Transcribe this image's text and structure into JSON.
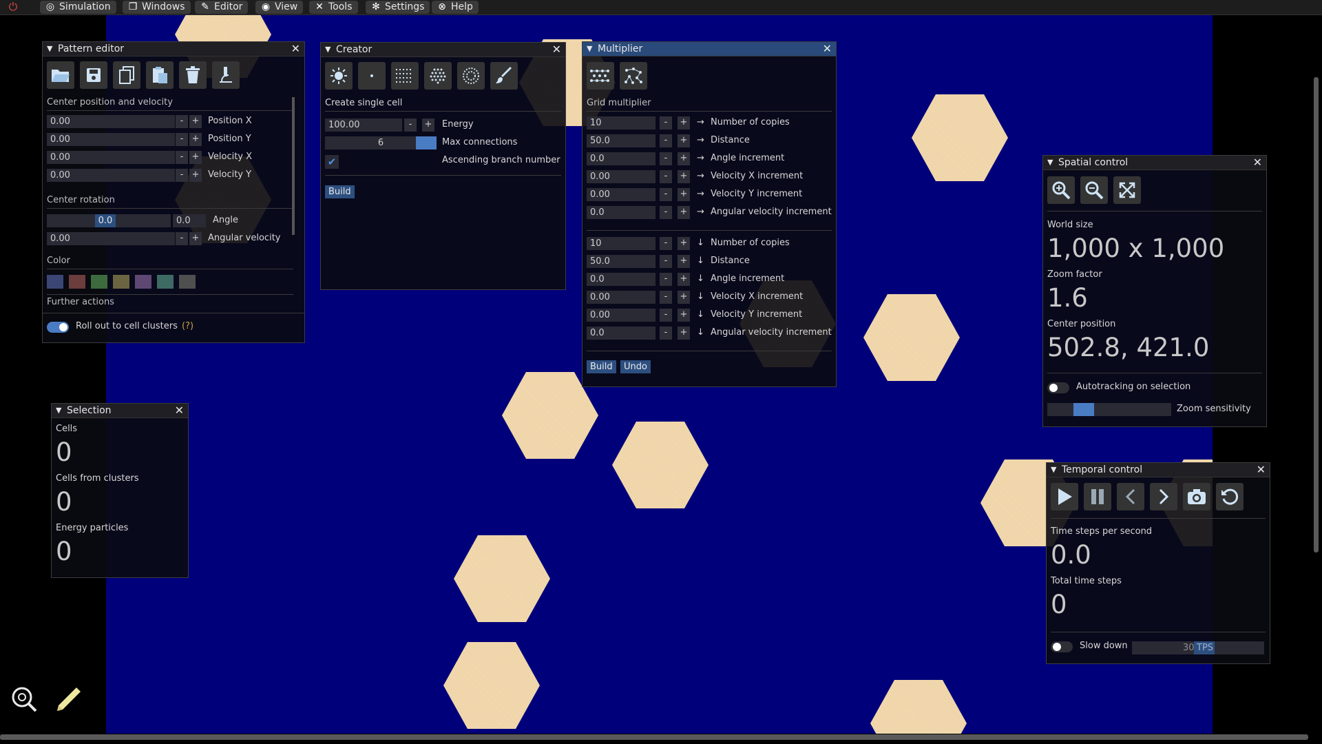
{
  "menu": {
    "items": [
      {
        "label": "Simulation",
        "icon": "gamepad-icon"
      },
      {
        "label": "Windows",
        "icon": "windows-icon"
      },
      {
        "label": "Editor",
        "icon": "pencil-icon"
      },
      {
        "label": "View",
        "icon": "eye-icon"
      },
      {
        "label": "Tools",
        "icon": "tools-icon"
      },
      {
        "label": "Settings",
        "icon": "gear-icon"
      },
      {
        "label": "Help",
        "icon": "help-icon"
      }
    ]
  },
  "pattern_editor": {
    "title": "Pattern editor",
    "section_center": "Center position and velocity",
    "rows": [
      {
        "value": "0.00",
        "label": "Position X"
      },
      {
        "value": "0.00",
        "label": "Position Y"
      },
      {
        "value": "0.00",
        "label": "Velocity X"
      },
      {
        "value": "0.00",
        "label": "Velocity Y"
      }
    ],
    "section_rotation": "Center rotation",
    "angle_value": "0.0",
    "angle_value2": "0.0",
    "angle_label": "Angle",
    "angular_velocity_value": "0.00",
    "angular_velocity_label": "Angular velocity",
    "section_color": "Color",
    "colors": [
      "#3b4675",
      "#6b3d3d",
      "#3d6b3d",
      "#6b6440",
      "#5e4873",
      "#3d6b63",
      "#4f4f4f"
    ],
    "section_further": "Further actions",
    "rollout_label": "Roll out to cell clusters",
    "rollout_help": "(?)"
  },
  "creator": {
    "title": "Creator",
    "mode": "Create single cell",
    "energy_value": "100.00",
    "energy_label": "Energy",
    "max_conn_value": "6",
    "max_conn_label": "Max connections",
    "ascending_label": "Ascending branch number",
    "build": "Build"
  },
  "multiplier": {
    "title": "Multiplier",
    "section": "Grid multiplier",
    "rows": [
      {
        "value": "10",
        "label": "Number of copies",
        "arrow": "→"
      },
      {
        "value": "50.0",
        "label": "Distance",
        "arrow": "→"
      },
      {
        "value": "0.0",
        "label": "Angle increment",
        "arrow": "→"
      },
      {
        "value": "0.00",
        "label": "Velocity X increment",
        "arrow": "→"
      },
      {
        "value": "0.00",
        "label": "Velocity Y increment",
        "arrow": "→"
      },
      {
        "value": "0.0",
        "label": "Angular velocity increment",
        "arrow": "→"
      },
      {
        "value": "10",
        "label": "Number of copies",
        "arrow": "↓"
      },
      {
        "value": "50.0",
        "label": "Distance",
        "arrow": "↓"
      },
      {
        "value": "0.0",
        "label": "Angle increment",
        "arrow": "↓"
      },
      {
        "value": "0.00",
        "label": "Velocity X increment",
        "arrow": "↓"
      },
      {
        "value": "0.00",
        "label": "Velocity Y increment",
        "arrow": "↓"
      },
      {
        "value": "0.0",
        "label": "Angular velocity increment",
        "arrow": "↓"
      }
    ],
    "build": "Build",
    "undo": "Undo"
  },
  "spatial": {
    "title": "Spatial control",
    "world_size_label": "World size",
    "world_size": "1,000 x 1,000",
    "zoom_label": "Zoom factor",
    "zoom": "1.6",
    "center_label": "Center position",
    "center": "502.8, 421.0",
    "autotracking": "Autotracking on selection",
    "zoom_sensitivity": "Zoom sensitivity",
    "zoom_sensitivity_level": 0.25
  },
  "temporal": {
    "title": "Temporal control",
    "tps_label": "Time steps per second",
    "tps": "0.0",
    "total_label": "Total time steps",
    "total": "0",
    "slowdown": "Slow down",
    "slowdown_value": "30",
    "slowdown_unit": "TPS"
  },
  "selection": {
    "title": "Selection",
    "cells_label": "Cells",
    "cells": "0",
    "clusters_label": "Cells from clusters",
    "clusters": "0",
    "particles_label": "Energy particles",
    "particles": "0"
  }
}
